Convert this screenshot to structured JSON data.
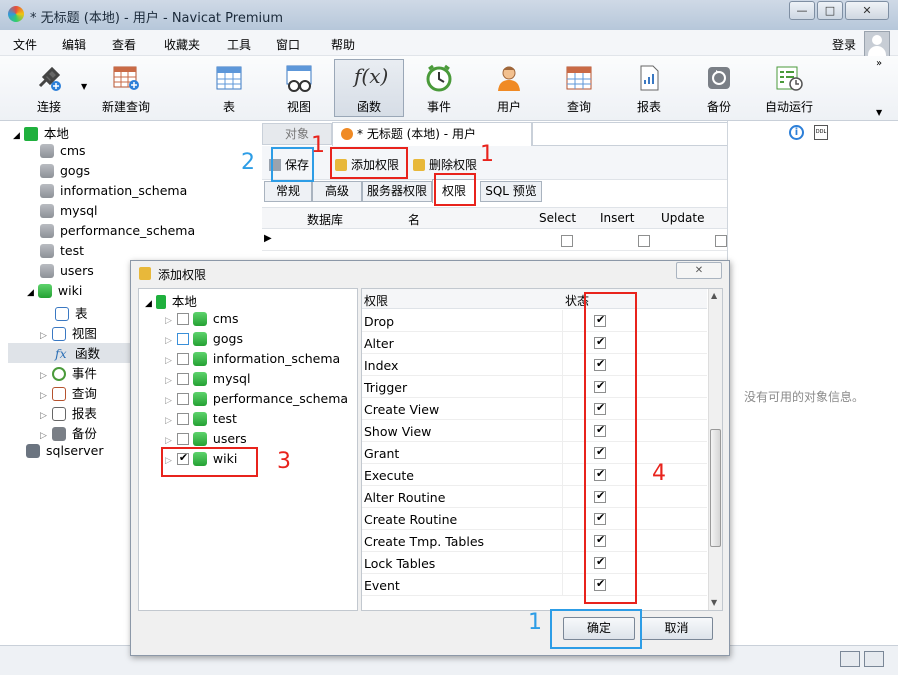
{
  "window": {
    "title": "* 无标题 (本地) - 用户 - Navicat Premium"
  },
  "menu": [
    "文件",
    "编辑",
    "查看",
    "收藏夹",
    "工具",
    "窗口",
    "帮助"
  ],
  "login": "登录",
  "toolbar": [
    {
      "label": "连接",
      "icon": "plug-icon"
    },
    {
      "label": "新建查询",
      "icon": "new-query-icon"
    },
    {
      "label": "表",
      "icon": "table-icon"
    },
    {
      "label": "视图",
      "icon": "view-icon"
    },
    {
      "label": "函数",
      "icon": "function-icon"
    },
    {
      "label": "事件",
      "icon": "clock-icon"
    },
    {
      "label": "用户",
      "icon": "user-icon"
    },
    {
      "label": "查询",
      "icon": "query-icon"
    },
    {
      "label": "报表",
      "icon": "report-icon"
    },
    {
      "label": "备份",
      "icon": "backup-icon"
    },
    {
      "label": "自动运行",
      "icon": "schedule-icon"
    }
  ],
  "sidebar": {
    "root": "本地",
    "databases": [
      "cms",
      "gogs",
      "information_schema",
      "mysql",
      "performance_schema",
      "test",
      "users",
      "wiki"
    ],
    "wiki_children": [
      "表",
      "视图",
      "函数",
      "事件",
      "查询",
      "报表",
      "备份"
    ],
    "other_connection": "sqlserver"
  },
  "tabs": {
    "objects": "对象",
    "user_tab": "* 无标题 (本地) - 用户"
  },
  "user_toolbar": {
    "save": "保存",
    "add_priv": "添加权限",
    "del_priv": "删除权限"
  },
  "subtabs": [
    "常规",
    "高级",
    "服务器权限",
    "权限",
    "SQL 预览"
  ],
  "priv_table": {
    "headers": [
      "数据库",
      "名",
      "Select",
      "Insert",
      "Update"
    ]
  },
  "right_panel": {
    "empty": "没有可用的对象信息。"
  },
  "dialog": {
    "title": "添加权限",
    "tree_root": "本地",
    "databases": [
      {
        "name": "cms",
        "checked": false
      },
      {
        "name": "gogs",
        "checked": false
      },
      {
        "name": "information_schema",
        "checked": false
      },
      {
        "name": "mysql",
        "checked": false
      },
      {
        "name": "performance_schema",
        "checked": false
      },
      {
        "name": "test",
        "checked": false
      },
      {
        "name": "users",
        "checked": false
      },
      {
        "name": "wiki",
        "checked": true
      }
    ],
    "grid_headers": {
      "priv": "权限",
      "status": "状态"
    },
    "privileges": [
      {
        "name": "Drop",
        "on": true
      },
      {
        "name": "Alter",
        "on": true
      },
      {
        "name": "Index",
        "on": true
      },
      {
        "name": "Trigger",
        "on": true
      },
      {
        "name": "Create View",
        "on": true
      },
      {
        "name": "Show View",
        "on": true
      },
      {
        "name": "Grant",
        "on": true
      },
      {
        "name": "Execute",
        "on": true
      },
      {
        "name": "Alter Routine",
        "on": true
      },
      {
        "name": "Create Routine",
        "on": true
      },
      {
        "name": "Create Tmp. Tables",
        "on": true
      },
      {
        "name": "Lock Tables",
        "on": true
      },
      {
        "name": "Event",
        "on": true
      }
    ],
    "ok": "确定",
    "cancel": "取消"
  },
  "annotations": [
    "1",
    "2",
    "1",
    "3",
    "4",
    "1"
  ],
  "colors": {
    "annotation_red": "#e8231c",
    "annotation_blue": "#2d9de6"
  }
}
